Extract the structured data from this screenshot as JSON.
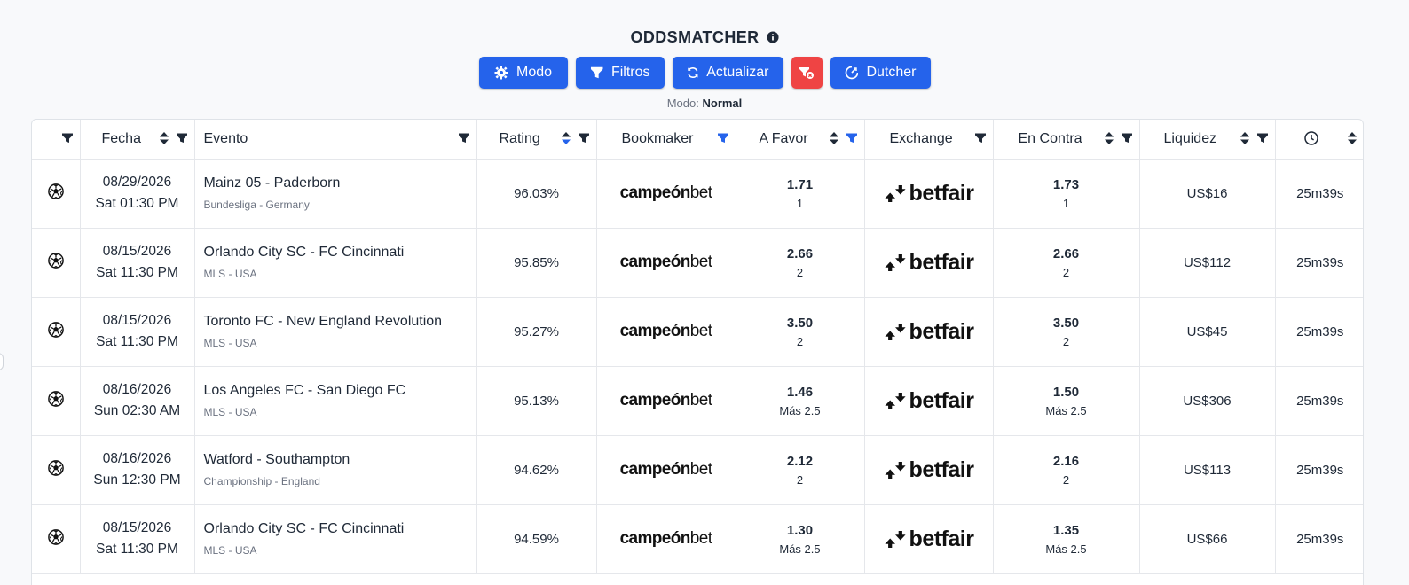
{
  "app": {
    "title": "ODDSMATCHER",
    "mode_label": "Modo:",
    "mode_value": "Normal"
  },
  "toolbar": {
    "modo": "Modo",
    "filtros": "Filtros",
    "actualizar": "Actualizar",
    "dutcher": "Dutcher"
  },
  "colors": {
    "primary": "#2563eb",
    "danger": "#ef4444",
    "active_filter": "#2563eb"
  },
  "table": {
    "columns": {
      "fecha": "Fecha",
      "evento": "Evento",
      "rating": "Rating",
      "bookmaker": "Bookmaker",
      "a_favor": "A Favor",
      "exchange": "Exchange",
      "en_contra": "En Contra",
      "liquidez": "Liquidez"
    },
    "rows": [
      {
        "date": "08/29/2026",
        "time": "Sat 01:30 PM",
        "event": "Mainz 05 - Paderborn",
        "league": "Bundesliga - Germany",
        "rating": "96.03%",
        "bookmaker_a": "campeón",
        "bookmaker_b": "bet",
        "favor_odds": "1.71",
        "favor_sel": "1",
        "exchange": "betfair",
        "contra_odds": "1.73",
        "contra_sel": "1",
        "liquidez": "US$16",
        "time_left": "25m39s"
      },
      {
        "date": "08/15/2026",
        "time": "Sat 11:30 PM",
        "event": "Orlando City SC - FC Cincinnati",
        "league": "MLS - USA",
        "rating": "95.85%",
        "bookmaker_a": "campeón",
        "bookmaker_b": "bet",
        "favor_odds": "2.66",
        "favor_sel": "2",
        "exchange": "betfair",
        "contra_odds": "2.66",
        "contra_sel": "2",
        "liquidez": "US$112",
        "time_left": "25m39s"
      },
      {
        "date": "08/15/2026",
        "time": "Sat 11:30 PM",
        "event": "Toronto FC - New England Revolution",
        "league": "MLS - USA",
        "rating": "95.27%",
        "bookmaker_a": "campeón",
        "bookmaker_b": "bet",
        "favor_odds": "3.50",
        "favor_sel": "2",
        "exchange": "betfair",
        "contra_odds": "3.50",
        "contra_sel": "2",
        "liquidez": "US$45",
        "time_left": "25m39s"
      },
      {
        "date": "08/16/2026",
        "time": "Sun 02:30 AM",
        "event": "Los Angeles FC - San Diego FC",
        "league": "MLS - USA",
        "rating": "95.13%",
        "bookmaker_a": "campeón",
        "bookmaker_b": "bet",
        "favor_odds": "1.46",
        "favor_sel": "Más 2.5",
        "exchange": "betfair",
        "contra_odds": "1.50",
        "contra_sel": "Más 2.5",
        "liquidez": "US$306",
        "time_left": "25m39s"
      },
      {
        "date": "08/16/2026",
        "time": "Sun 12:30 PM",
        "event": "Watford - Southampton",
        "league": "Championship - England",
        "rating": "94.62%",
        "bookmaker_a": "campeón",
        "bookmaker_b": "bet",
        "favor_odds": "2.12",
        "favor_sel": "2",
        "exchange": "betfair",
        "contra_odds": "2.16",
        "contra_sel": "2",
        "liquidez": "US$113",
        "time_left": "25m39s"
      },
      {
        "date": "08/15/2026",
        "time": "Sat 11:30 PM",
        "event": "Orlando City SC - FC Cincinnati",
        "league": "MLS - USA",
        "rating": "94.59%",
        "bookmaker_a": "campeón",
        "bookmaker_b": "bet",
        "favor_odds": "1.30",
        "favor_sel": "Más 2.5",
        "exchange": "betfair",
        "contra_odds": "1.35",
        "contra_sel": "Más 2.5",
        "liquidez": "US$66",
        "time_left": "25m39s"
      }
    ]
  }
}
